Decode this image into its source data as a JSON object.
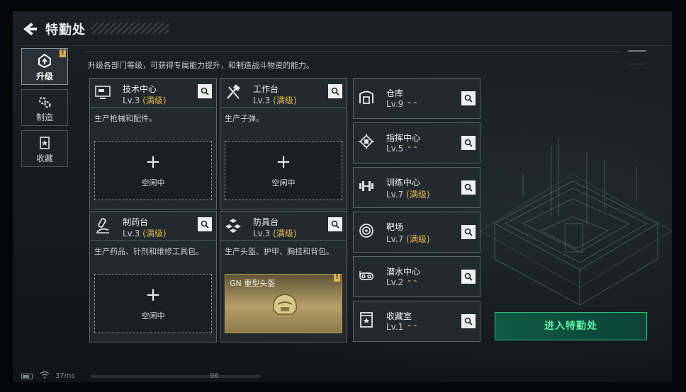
{
  "header": {
    "title": "特勤处",
    "back_icon": "back-arrow-icon"
  },
  "sidebar": {
    "tabs": [
      {
        "label": "升级",
        "icon": "upgrade-icon",
        "active": true,
        "badge": "!"
      },
      {
        "label": "制造",
        "icon": "craft-gear-icon",
        "active": false
      },
      {
        "label": "收藏",
        "icon": "collection-icon",
        "active": false
      }
    ]
  },
  "description": "升级各部门等级，可获得专属能力提升，和制造战斗物资的能力。",
  "departments": [
    {
      "name": "技术中心",
      "level": "Lv.3",
      "max": "(满级)",
      "desc": "生产枪械和配件。",
      "slot": {
        "plus": "+",
        "status": "空闲中"
      },
      "icon": "tech-center-icon"
    },
    {
      "name": "工作台",
      "level": "Lv.3",
      "max": "(满级)",
      "desc": "生产子弹。",
      "slot": {
        "plus": "+",
        "status": "空闲中"
      },
      "icon": "workbench-icon"
    },
    {
      "name": "制药台",
      "level": "Lv.3",
      "max": "(满级)",
      "desc": "生产药品、针剂和维修工具包。",
      "slot": {
        "plus": "+",
        "status": "空闲中"
      },
      "icon": "pharmacy-icon"
    },
    {
      "name": "防具台",
      "level": "Lv.3",
      "max": "(满级)",
      "desc": "生产头盔、护甲、胸挂和背包。",
      "slot_item": {
        "name": "GN 重型头盔",
        "badge": "!"
      },
      "icon": "armor-bench-icon"
    }
  ],
  "facilities": [
    {
      "name": "仓库",
      "level": "Lv.9",
      "max": "",
      "up": "⌃⌃",
      "icon": "warehouse-icon"
    },
    {
      "name": "指挥中心",
      "level": "Lv.5",
      "max": "",
      "up": "⌃⌃",
      "icon": "command-center-icon"
    },
    {
      "name": "训练中心",
      "level": "Lv.7",
      "max": "(满级)",
      "up": "",
      "icon": "training-center-icon"
    },
    {
      "name": "靶场",
      "level": "Lv.7",
      "max": "(满级)",
      "up": "",
      "icon": "shooting-range-icon"
    },
    {
      "name": "潜水中心",
      "level": "Lv.2",
      "max": "",
      "up": "⌃⌃",
      "icon": "diving-center-icon"
    },
    {
      "name": "收藏室",
      "level": "Lv.1",
      "max": "",
      "up": "⌃⌃",
      "icon": "collection-room-icon"
    }
  ],
  "enter_button": "进入特勤处",
  "status": {
    "ping": "37ms",
    "number": "96"
  },
  "colors": {
    "accent_gold": "#e0b74e",
    "accent_green": "#2fbf7c",
    "card_border": "#5a6469"
  }
}
